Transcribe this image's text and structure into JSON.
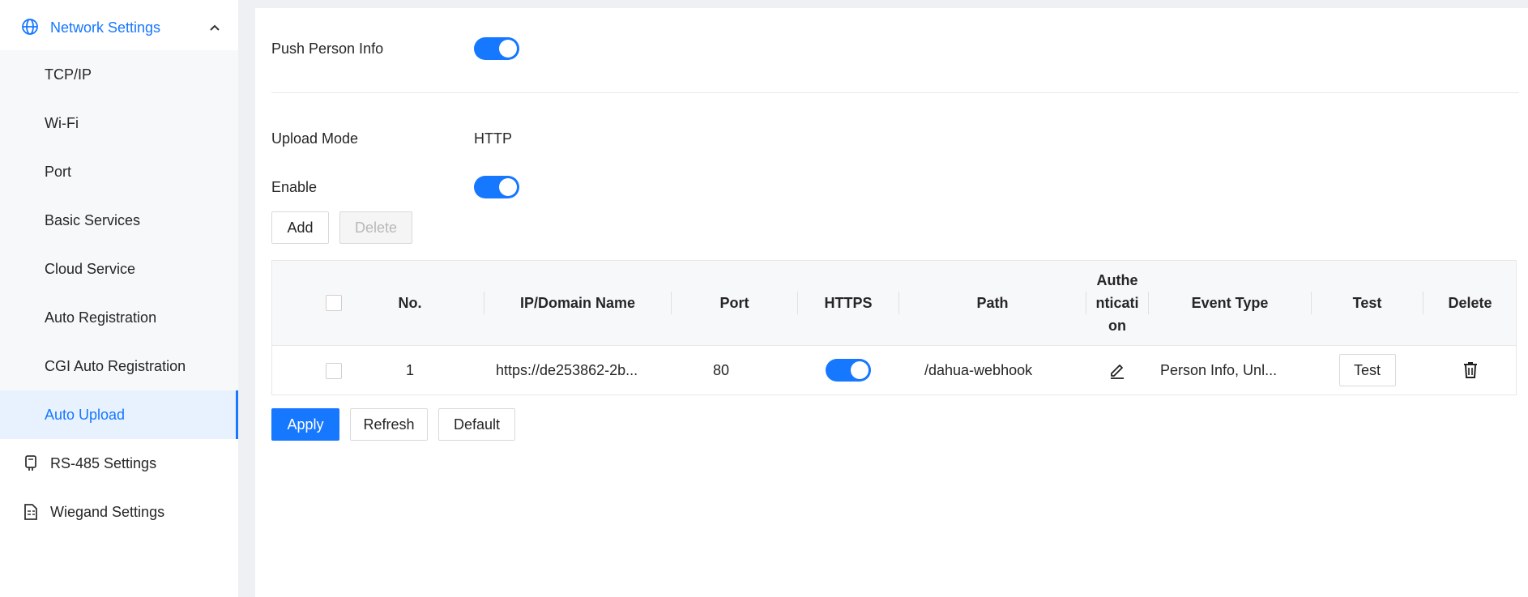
{
  "sidebar": {
    "group": {
      "label": "Network Settings",
      "icon": "globe-icon",
      "expanded": true
    },
    "submenu": [
      {
        "label": "TCP/IP"
      },
      {
        "label": "Wi-Fi"
      },
      {
        "label": "Port"
      },
      {
        "label": "Basic Services"
      },
      {
        "label": "Cloud Service"
      },
      {
        "label": "Auto Registration"
      },
      {
        "label": "CGI Auto Registration"
      },
      {
        "label": "Auto Upload",
        "active": true
      }
    ],
    "items": [
      {
        "label": "RS-485 Settings",
        "icon": "rs485-icon"
      },
      {
        "label": "Wiegand Settings",
        "icon": "wiegand-icon"
      }
    ]
  },
  "main": {
    "push_person_info": {
      "label": "Push Person Info",
      "enabled": true
    },
    "upload_mode": {
      "label": "Upload Mode",
      "value": "HTTP"
    },
    "enable": {
      "label": "Enable",
      "enabled": true
    },
    "buttons": {
      "add": "Add",
      "delete": "Delete"
    },
    "table": {
      "headers": {
        "no": "No.",
        "ip": "IP/Domain Name",
        "port": "Port",
        "https": "HTTPS",
        "path": "Path",
        "auth_1": "Authe",
        "auth_2": "nticati",
        "auth_3": "on",
        "event_type": "Event Type",
        "test": "Test",
        "delete": "Delete"
      },
      "rows": [
        {
          "no": "1",
          "ip": "https://de253862-2b...",
          "port": "80",
          "https": true,
          "path": "/dahua-webhook",
          "event_type": "Person Info, Unl...",
          "test_label": "Test"
        }
      ]
    },
    "footer_buttons": {
      "apply": "Apply",
      "refresh": "Refresh",
      "default": "Default"
    }
  },
  "colors": {
    "accent": "#1677ff",
    "active_bg": "#e8f2ff",
    "page_bg": "#eef0f4"
  }
}
